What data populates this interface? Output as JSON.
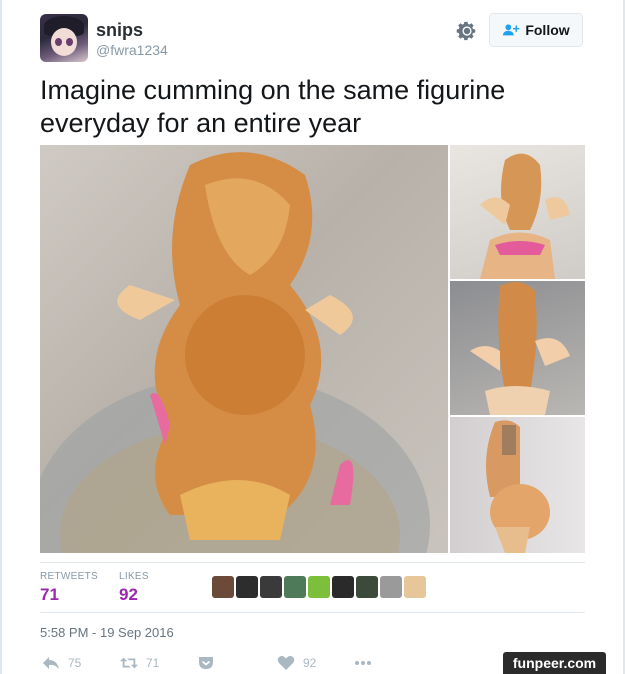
{
  "user": {
    "name": "snips",
    "handle": "@fwra1234"
  },
  "follow_button": {
    "label": "Follow"
  },
  "tweet": {
    "text": "Imagine cumming on the same figurine everyday for an entire year",
    "timestamp": "5:58 PM - 19 Sep 2016"
  },
  "stats": {
    "retweets_label": "RETWEETS",
    "retweets_value": "71",
    "likes_label": "LIKES",
    "likes_value": "92"
  },
  "actions": {
    "reply_count": "75",
    "retweet_count": "71",
    "like_count": "92"
  },
  "photos": [
    {
      "name": "main-photo"
    },
    {
      "name": "side-photo-top"
    },
    {
      "name": "side-photo-middle"
    },
    {
      "name": "side-photo-bottom"
    }
  ],
  "likers": [
    "#6b4a3a",
    "#2d2d2d",
    "#3a3a3a",
    "#4e7a5a",
    "#7cbf3a",
    "#2a2a2a",
    "#3c4a3c",
    "#9a9a9a",
    "#e7c79a"
  ],
  "watermark": "funpeer.com",
  "colors": {
    "stat_value": "#9b27af",
    "meta_gray": "#8899a6"
  }
}
